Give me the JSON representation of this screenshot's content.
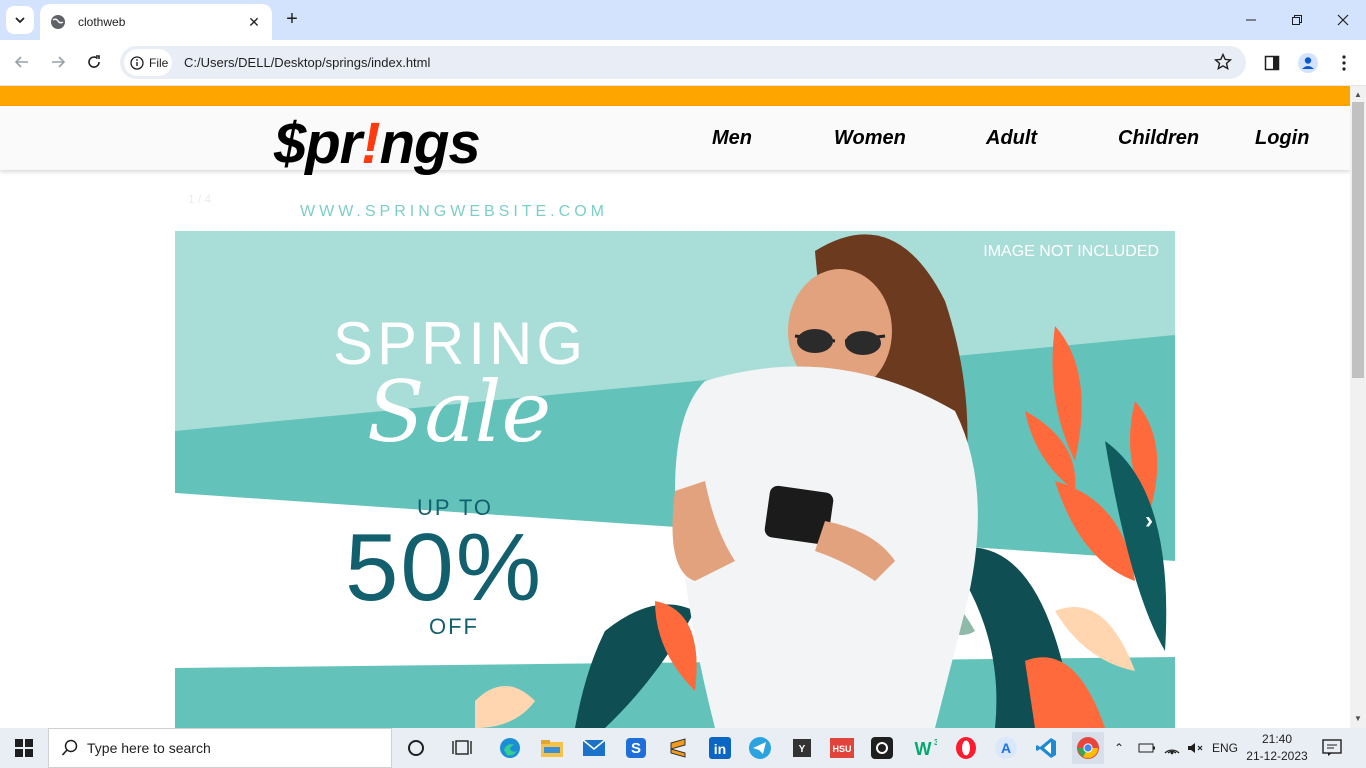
{
  "browser": {
    "tab_title": "clothweb",
    "chip_label": "File",
    "url": "C:/Users/DELL/Desktop/springs/index.html"
  },
  "site": {
    "logo_prefix": "$pr",
    "logo_bang": "!",
    "logo_suffix": "ngs",
    "menu": [
      "Men",
      "Women",
      "Adult",
      "Children",
      "Login"
    ]
  },
  "slider": {
    "counter": "1 / 4",
    "website": "WWW.SPRINGWEBSITE.COM",
    "image_note": "IMAGE NOT INCLUDED",
    "headline": "SPRING",
    "script_word": "Sale",
    "up_to": "UP TO",
    "percent": "50%",
    "off": "OFF",
    "next_arrow": "›"
  },
  "taskbar": {
    "search_placeholder": "Type here to search",
    "lang": "ENG",
    "time": "21:40",
    "date": "21-12-2023"
  },
  "colors": {
    "accent_orange": "#ffa500",
    "logo_bang": "#ff3a0f",
    "banner_teal": "#a8ddd8",
    "banner_dark_teal": "#125f6e"
  }
}
